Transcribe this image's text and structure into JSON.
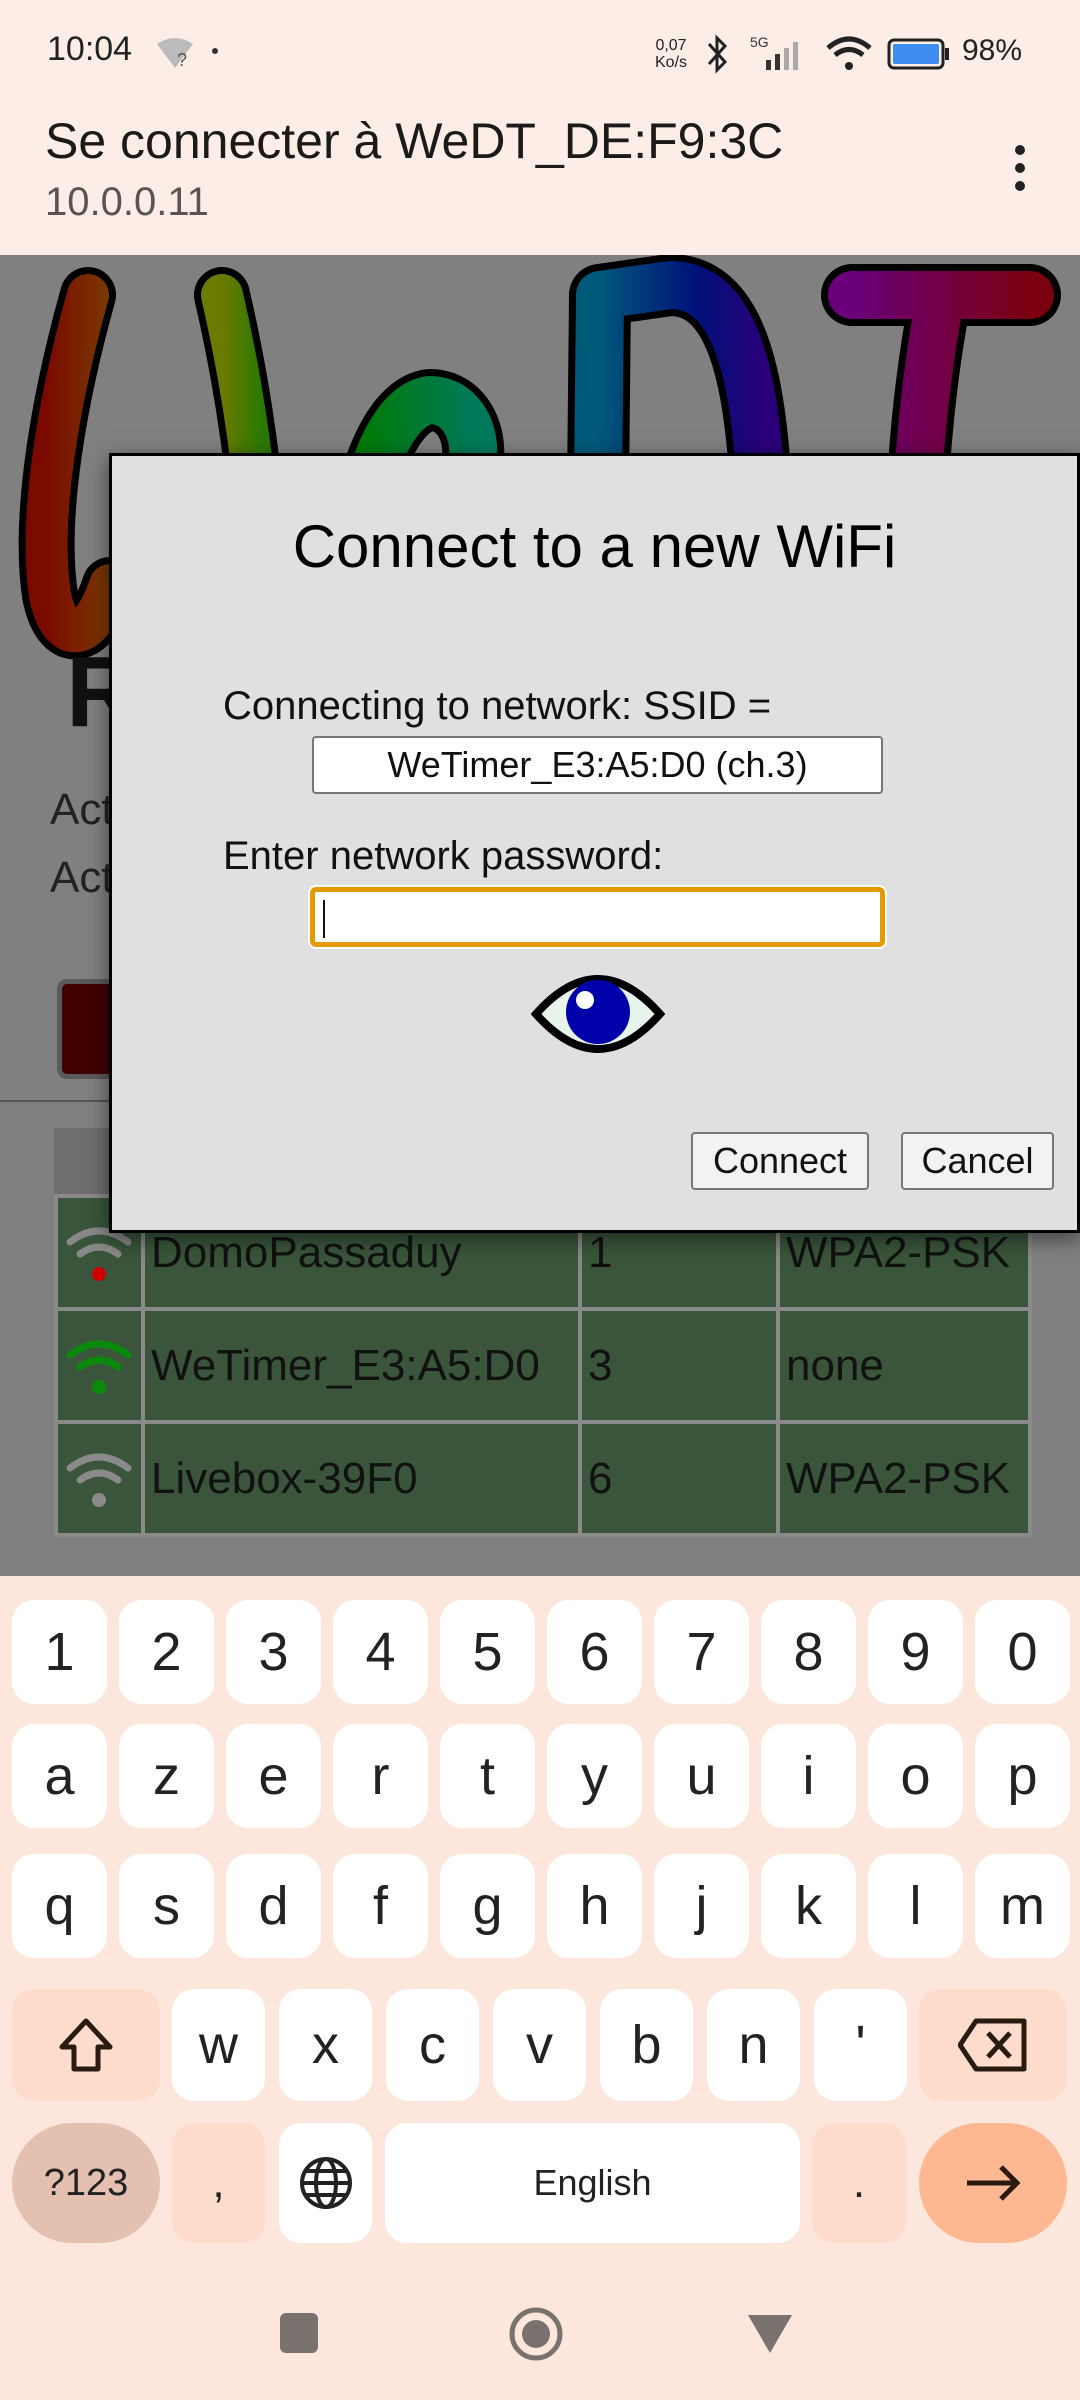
{
  "status": {
    "time": "10:04",
    "net_speed_value": "0,07",
    "net_speed_unit": "Ko/s",
    "network": "5G",
    "battery": "98%"
  },
  "appbar": {
    "title": "Se connecter à WeDT_DE:F9:3C",
    "subtitle": "10.0.0.11",
    "menu_icon": "more-vert-icon"
  },
  "background_page": {
    "logo_text": "WeDT",
    "heading_partial": "R",
    "lines_partial": [
      "Act",
      "Act"
    ],
    "networks": [
      {
        "ssid": "DomoPassaduy",
        "channel": "1",
        "security": "WPA2-PSK",
        "signal_color": "#888888",
        "dot_color": "#cc0000"
      },
      {
        "ssid": "WeTimer_E3:A5:D0",
        "channel": "3",
        "security": "none",
        "signal_color": "#0a8a0a",
        "dot_color": "#0a8a0a"
      },
      {
        "ssid": "Livebox-39F0",
        "channel": "6",
        "security": "WPA2-PSK",
        "signal_color": "#8a8a8a",
        "dot_color": "#8a8a8a"
      }
    ]
  },
  "dialog": {
    "title": "Connect to a new WiFi",
    "ssid_label": "Connecting to network: SSID =",
    "ssid_value": "WeTimer_E3:A5:D0 (ch.3)",
    "password_label": "Enter network password:",
    "password_value": "",
    "connect_label": "Connect",
    "cancel_label": "Cancel",
    "accent": "#e59a00"
  },
  "keyboard": {
    "row1": [
      "1",
      "2",
      "3",
      "4",
      "5",
      "6",
      "7",
      "8",
      "9",
      "0"
    ],
    "row2": [
      "a",
      "z",
      "e",
      "r",
      "t",
      "y",
      "u",
      "i",
      "o",
      "p"
    ],
    "row3": [
      "q",
      "s",
      "d",
      "f",
      "g",
      "h",
      "j",
      "k",
      "l",
      "m"
    ],
    "row4": [
      "w",
      "x",
      "c",
      "v",
      "b",
      "n",
      "'"
    ],
    "symbols_label": "?123",
    "comma": ",",
    "space_label": "English",
    "period": "."
  }
}
